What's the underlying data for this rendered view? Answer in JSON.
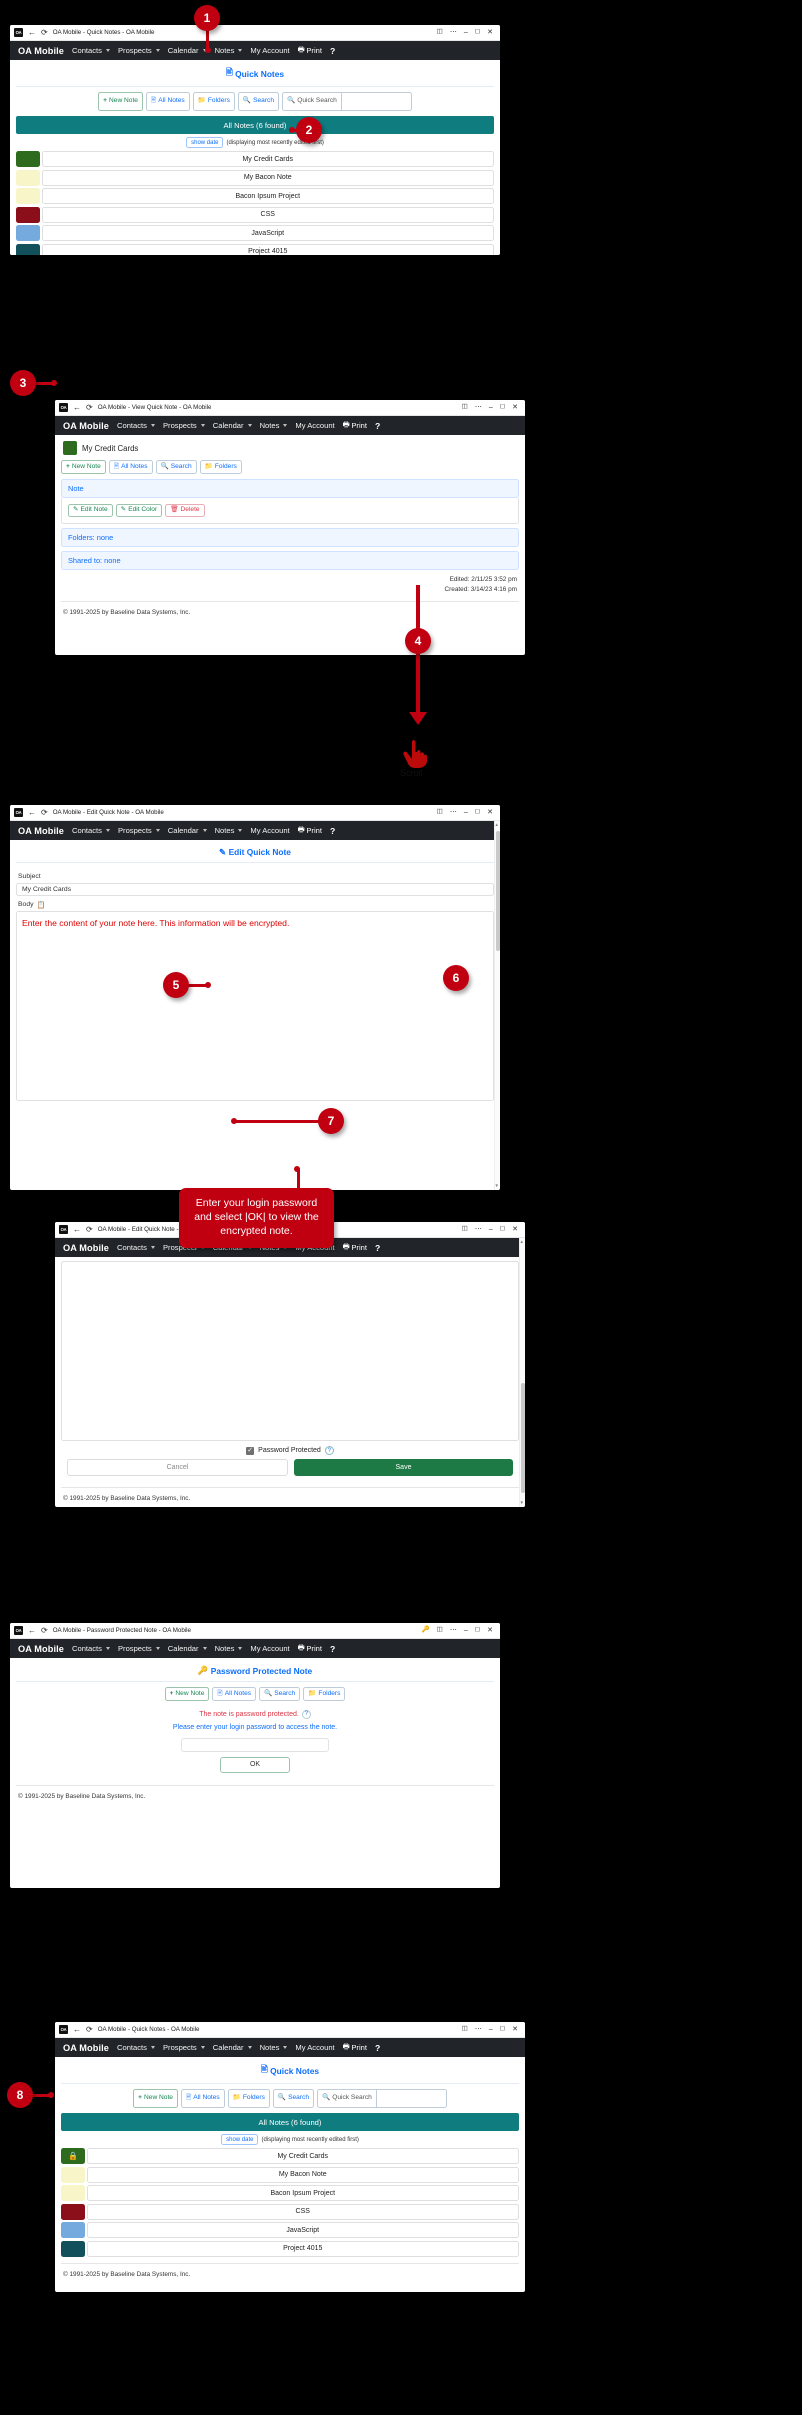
{
  "app": {
    "brand": "OA Mobile"
  },
  "nav": {
    "items": [
      {
        "label": "Contacts",
        "caret": true
      },
      {
        "label": "Prospects",
        "caret": true
      },
      {
        "label": "Calendar",
        "caret": true
      },
      {
        "label": "Notes",
        "caret": true
      },
      {
        "label": "My Account",
        "caret": false
      }
    ],
    "print": "Print",
    "help": "?"
  },
  "footer": {
    "copyright": "© 1991-2025 by Baseline Data Systems, Inc."
  },
  "panel1": {
    "window_title": "OA Mobile - Quick Notes - OA Mobile",
    "page_title": "Quick Notes",
    "toolbar": {
      "new_note": "New Note",
      "all_notes": "All Notes",
      "folders": "Folders",
      "search": "Search",
      "quick_search": "Quick Search",
      "quick_search_value": ""
    },
    "results_bar": "All Notes (6 found)",
    "show_date": "show date",
    "sort_note": "(displaying most recently edited first)",
    "notes": [
      {
        "title": "My Credit Cards",
        "color": "#2e6b1f",
        "locked": false
      },
      {
        "title": "My Bacon Note",
        "color": "#f8f6c8",
        "locked": false
      },
      {
        "title": "Bacon Ipsum Project",
        "color": "#f8f6c8",
        "locked": false
      },
      {
        "title": "CSS",
        "color": "#8b0f1a",
        "locked": false
      },
      {
        "title": "JavaScript",
        "color": "#74aade",
        "locked": false
      },
      {
        "title": "Project 4015",
        "color": "#12505c",
        "locked": false
      }
    ]
  },
  "panel2": {
    "window_title": "OA Mobile - View Quick Note - OA Mobile",
    "note_title": "My Credit Cards",
    "note_color": "#2e6b1f",
    "toolbar": {
      "new_note": "New Note",
      "all_notes": "All Notes",
      "search": "Search",
      "folders": "Folders"
    },
    "section_note": "Note",
    "actions": {
      "edit_note": "Edit Note",
      "edit_color": "Edit Color",
      "delete": "Delete"
    },
    "folders": "Folders: none",
    "shared": "Shared to: none",
    "edited": "Edited: 2/11/25 3:52 pm",
    "created": "Created: 3/14/23 4:16 pm"
  },
  "panel3": {
    "window_title": "OA Mobile - Edit Quick Note - OA Mobile",
    "page_title": "Edit Quick Note",
    "subject_label": "Subject",
    "subject_value": "My Credit Cards",
    "body_label": "Body",
    "body_value": "Enter the content of your note here. This information will be encrypted.",
    "scroll_label": "Scroll"
  },
  "panel4": {
    "window_title": "OA Mobile - Edit Quick Note - OA Mobile",
    "password_protected": "Password Protected",
    "help_mark": "?",
    "cancel": "Cancel",
    "save": "Save"
  },
  "panel5": {
    "window_title": "OA Mobile - Password Protected Note - OA Mobile",
    "page_title": "Password Protected Note",
    "toolbar": {
      "new_note": "New Note",
      "all_notes": "All Notes",
      "search": "Search",
      "folders": "Folders"
    },
    "warning": "The note is password protected.",
    "help_mark": "?",
    "instruction": "Please enter your login password to access the note.",
    "password_value": "",
    "ok": "OK",
    "tip": "Enter your login password and select |OK| to view the encrypted note."
  },
  "panel6": {
    "window_title": "OA Mobile - Quick Notes - OA Mobile",
    "page_title": "Quick Notes",
    "results_bar": "All Notes (6 found)",
    "show_date": "show date",
    "sort_note": "(displaying most recently edited first)",
    "notes": [
      {
        "title": "My Credit Cards",
        "color": "#2e6b1f",
        "locked": true
      },
      {
        "title": "My Bacon Note",
        "color": "#f8f6c8",
        "locked": false
      },
      {
        "title": "Bacon Ipsum Project",
        "color": "#f8f6c8",
        "locked": false
      },
      {
        "title": "CSS",
        "color": "#8b0f1a",
        "locked": false
      },
      {
        "title": "JavaScript",
        "color": "#74aade",
        "locked": false
      },
      {
        "title": "Project 4015",
        "color": "#12505c",
        "locked": false
      }
    ]
  },
  "callouts": {
    "c1": "1",
    "c2": "2",
    "c3": "3",
    "c4": "4",
    "c5": "5",
    "c6": "6",
    "c7": "7",
    "c8": "8"
  }
}
